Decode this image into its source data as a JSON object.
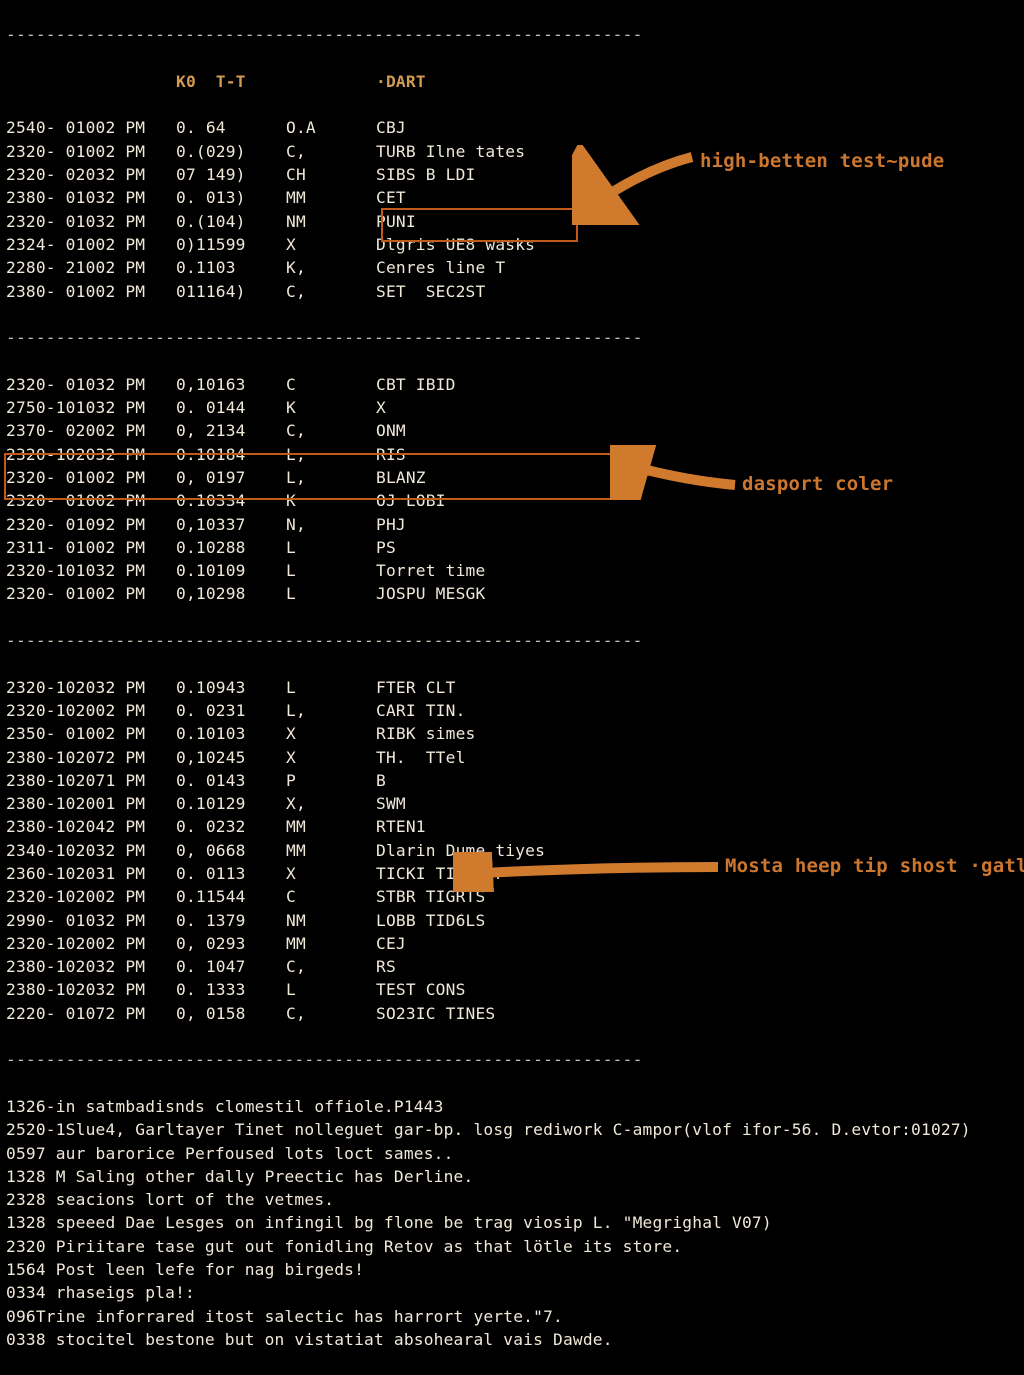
{
  "colors": {
    "fg": "#f0e8d8",
    "accent": "#d39a52",
    "arrow": "#d07a2e",
    "box": "#c25a1a",
    "ann": "#cd762e"
  },
  "header": {
    "k": "K0  T-T",
    "dart": "·DART"
  },
  "sep": "----------------------------------------------------------------",
  "rows1": [
    {
      "d": "2540- 01002 PM",
      "k": "0. 64",
      "t": "O.A",
      "x": "CBJ"
    },
    {
      "d": "2320- 01002 PM",
      "k": "0.(029)",
      "t": "C,",
      "x": "TURB Ilne tates"
    },
    {
      "d": "2320- 02032 PM",
      "k": "07 149)",
      "t": "CH",
      "x": "SIBS B LDI"
    },
    {
      "d": "2380- 01032 PM",
      "k": "0. 013)",
      "t": "MM",
      "x": "CET"
    },
    {
      "d": "2320- 01032 PM",
      "k": "0.(104)",
      "t": "NM",
      "x": "PUNI"
    },
    {
      "d": "2324- 01002 PM",
      "k": "0)11599",
      "t": "X",
      "x": "Dlgris UE8 wasks"
    },
    {
      "d": "2280- 21002 PM",
      "k": "0.1103",
      "t": "K,",
      "x": "Cenres line T"
    },
    {
      "d": "2380- 01002 PM",
      "k": "011164)",
      "t": "C,",
      "x": "SET  SEC2ST"
    }
  ],
  "rows2": [
    {
      "d": "2320- 01032 PM",
      "k": "0,10163",
      "t": "C",
      "x": "CBT IBID"
    },
    {
      "d": "2750-101032 PM",
      "k": "0. 0144",
      "t": "K",
      "x": "X"
    },
    {
      "d": "2370- 02002 PM",
      "k": "0, 2134",
      "t": "C,",
      "x": "ONM"
    },
    {
      "d": "2320-102032 PM",
      "k": "0.10184",
      "t": "L,",
      "x": "RIS"
    },
    {
      "d": "2320- 01002 PM",
      "k": "0, 0197",
      "t": "L,",
      "x": "BLANZ"
    },
    {
      "d": "2320- 01002 PM",
      "k": "0.10334",
      "t": "K",
      "x": "OJ LOBI"
    },
    {
      "d": "2320- 01092 PM",
      "k": "0,10337",
      "t": "N,",
      "x": "PHJ"
    },
    {
      "d": "2311- 01002 PM",
      "k": "0.10288",
      "t": "L",
      "x": "PS"
    },
    {
      "d": "2320-101032 PM",
      "k": "0.10109",
      "t": "L",
      "x": "Torret time"
    },
    {
      "d": "2320- 01002 PM",
      "k": "0,10298",
      "t": "L",
      "x": "JOSPU MESGK"
    }
  ],
  "rows3": [
    {
      "d": "2320-102032 PM",
      "k": "0.10943",
      "t": "L",
      "x": "FTER CLT"
    },
    {
      "d": "2320-102002 PM",
      "k": "0. 0231",
      "t": "L,",
      "x": "CARI TIN."
    },
    {
      "d": "2350- 01002 PM",
      "k": "0.10103",
      "t": "X",
      "x": "RIBK simes"
    },
    {
      "d": "2380-102072 PM",
      "k": "0,10245",
      "t": "X",
      "x": "TH.  TTel"
    },
    {
      "d": "2380-102071 PM",
      "k": "0. 0143",
      "t": "P",
      "x": "B"
    },
    {
      "d": "2380-102001 PM",
      "k": "0.10129",
      "t": "X,",
      "x": "SWM"
    },
    {
      "d": "2380-102042 PM",
      "k": "0. 0232",
      "t": "MM",
      "x": "RTEN1"
    },
    {
      "d": "2340-102032 PM",
      "k": "0, 0668",
      "t": "MM",
      "x": "Dlarin Dume tiyes"
    },
    {
      "d": "2360-102031 PM",
      "k": "0. 0113",
      "t": "X",
      "x": "TICKI TIlme F"
    },
    {
      "d": "2320-102002 PM",
      "k": "0.11544",
      "t": "C",
      "x": "STBR TIGRTS"
    },
    {
      "d": "2990- 01032 PM",
      "k": "0. 1379",
      "t": "NM",
      "x": "LOBB TID6LS"
    },
    {
      "d": "2320-102002 PM",
      "k": "0, 0293",
      "t": "MM",
      "x": "CEJ"
    },
    {
      "d": "2380-102032 PM",
      "k": "0. 1047",
      "t": "C,",
      "x": "RS"
    },
    {
      "d": "2380-102032 PM",
      "k": "0. 1333",
      "t": "L",
      "x": "TEST CONS"
    },
    {
      "d": "2220- 01072 PM",
      "k": "0, 0158",
      "t": "C,",
      "x": "SO23IC TINES"
    }
  ],
  "footer": [
    "1326-in satmbadisnds clomestil offiole.P1443",
    "2520-1Slue4, Garltayer Tinet nolleguet gar-bp. losg rediwork C-ampor(vlof ifor-56. D.evtor:01027)",
    "0597 aur barorice Perfoused lots loct sames..",
    "1328 M Saling other dally Preectic has Derline.",
    "2328 seacions lort of the vetmes.",
    "1328 speeed Dae Lesges on infingil bg flone be trag viosip L. \"Megrighal V07)",
    "2320 Piriitare tase gut out fonidling Retov as that lötle its store.",
    "1564 Post leen lefe for nag birgeds!",
    "0334 rhaseigs pla!:",
    "096Trine inforrared itost salectic has harrort yerte.\"7.",
    "0338 stocitel bestone but on vistatiat absohearal vais Dawde."
  ],
  "annotations": [
    {
      "label": "high-betten test~pude"
    },
    {
      "label": "dasport coler"
    },
    {
      "label": "Mosta heep tip shost ·gatled"
    }
  ]
}
